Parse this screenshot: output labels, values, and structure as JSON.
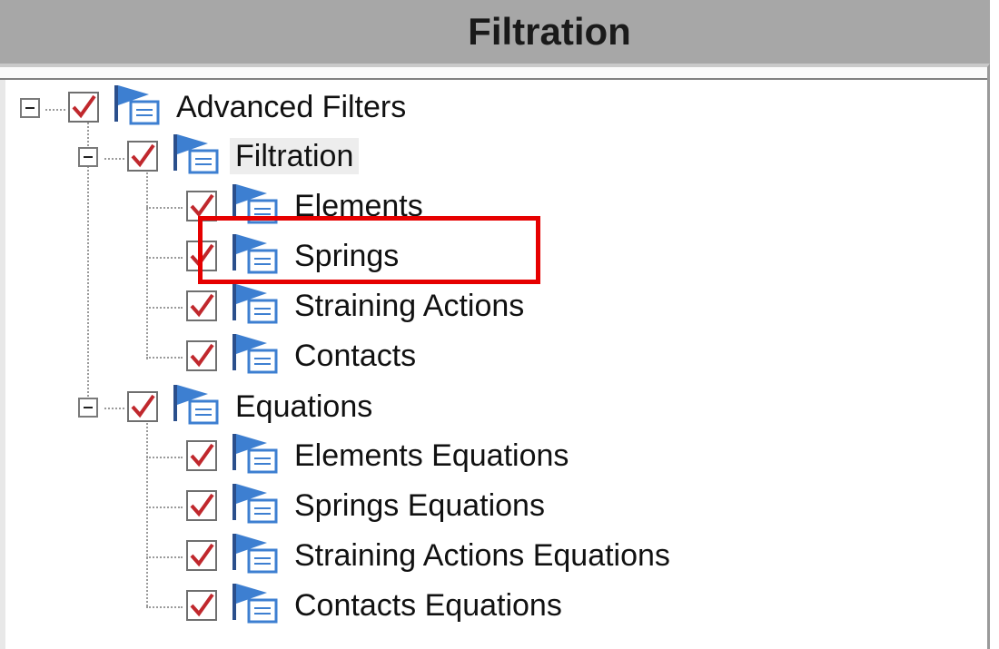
{
  "window": {
    "title": "Filtration"
  },
  "tree": {
    "root": {
      "label": "Advanced Filters",
      "checked": true,
      "expanded": true,
      "icon": "filter-flag-icon",
      "children": [
        {
          "label": "Filtration",
          "checked": true,
          "expanded": true,
          "selected": true,
          "icon": "filter-flag-icon",
          "children": [
            {
              "label": "Elements",
              "checked": true,
              "icon": "filter-flag-icon"
            },
            {
              "label": "Springs",
              "checked": true,
              "icon": "filter-flag-icon"
            },
            {
              "label": "Straining Actions",
              "checked": true,
              "icon": "filter-flag-icon"
            },
            {
              "label": "Contacts",
              "checked": true,
              "icon": "filter-flag-icon"
            }
          ]
        },
        {
          "label": "Equations",
          "checked": true,
          "expanded": true,
          "icon": "filter-flag-icon",
          "children": [
            {
              "label": "Elements Equations",
              "checked": true,
              "icon": "filter-flag-icon"
            },
            {
              "label": "Springs Equations",
              "checked": true,
              "icon": "filter-flag-icon"
            },
            {
              "label": "Straining Actions Equations",
              "checked": true,
              "icon": "filter-flag-icon"
            },
            {
              "label": "Contacts Equations",
              "checked": true,
              "icon": "filter-flag-icon"
            }
          ]
        }
      ]
    }
  },
  "annotation": {
    "highlight_target": "Springs",
    "color": "#e60000"
  },
  "colors": {
    "header_bg": "#a7a7a7",
    "checkmark": "#c0282d",
    "icon_blue": "#3d7fd1"
  }
}
